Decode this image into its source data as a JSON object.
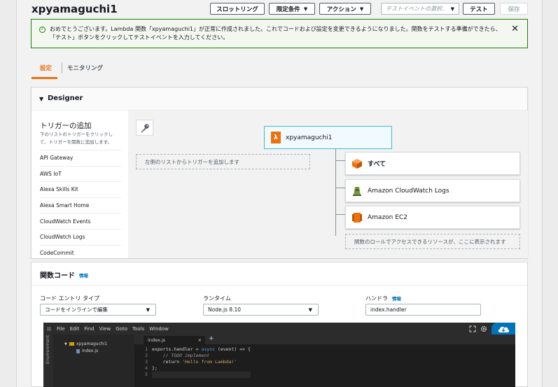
{
  "header": {
    "function_name": "xpyamaguchi1",
    "buttons": {
      "slots": "スロットリング",
      "qualifiers": "限定条件",
      "actions": "アクション",
      "test_select_placeholder": "テストイベントの選択..",
      "test": "テスト",
      "save": "保存"
    }
  },
  "alert": {
    "message": "おめでとうございます。Lambda 関数「xpyamaguchi1」が正常に作成されました。これでコードおよび設定を変更できるようになりました。関数をテストする準備ができたら、「テスト」ボタンをクリックしてテストイベントを入力してください。",
    "status_color": "#1d8102"
  },
  "tabs": [
    {
      "label": "設定",
      "active": true
    },
    {
      "label": "モニタリング",
      "active": false
    }
  ],
  "designer": {
    "title": "Designer",
    "triggers": {
      "title": "トリガーの追加",
      "description": "下のリストのトリガーをクリックして、トリガーを関数に追加します。",
      "items": [
        "API Gateway",
        "AWS IoT",
        "Alexa Skills Kit",
        "Alexa Smart Home",
        "CloudWatch Events",
        "CloudWatch Logs",
        "CodeCommit"
      ]
    },
    "trigger_drop_hint": "左側のリストからトリガーを追加します",
    "function_node": "xpyamaguchi1",
    "resources": [
      {
        "label": "すべて",
        "icon": "cube-icon",
        "bold": true
      },
      {
        "label": "Amazon CloudWatch Logs",
        "icon": "cloudwatch-icon",
        "bold": false
      },
      {
        "label": "Amazon EC2",
        "icon": "ec2-icon",
        "bold": false
      }
    ],
    "resource_drop_hint": "関数のロールでアクセスできるリソースが、ここに表示されます"
  },
  "function_code": {
    "title": "関数コード",
    "info": "情報",
    "entry_type_label": "コード エントリ タイプ",
    "entry_type_value": "コードをインラインで編集",
    "runtime_label": "ランタイム",
    "runtime_value": "Node.js 8.10",
    "handler_label": "ハンドラ",
    "handler_info": "情報",
    "handler_value": "index.handler"
  },
  "ide": {
    "menu": [
      "File",
      "Edit",
      "Find",
      "View",
      "Goto",
      "Tools",
      "Window"
    ],
    "sidebar_label": "Environment",
    "tree": {
      "folder": "xpyamaguchi1",
      "file": "index.js"
    },
    "tab": "index.js",
    "tab_close": "×",
    "plus": "+",
    "line_numbers": [
      "1",
      "2",
      "3",
      "4",
      "5"
    ],
    "code": {
      "line1_a": "exports.handler = ",
      "line1_kw": "async",
      "line1_b": " (event) => {",
      "line2": "    // TODO implement",
      "line3_a": "    return ",
      "line3_str": "'Hello from Lambda!'",
      "line4": "};"
    }
  },
  "colors": {
    "accent": "#ec7211",
    "link": "#0073bb",
    "success": "#1d8102"
  }
}
